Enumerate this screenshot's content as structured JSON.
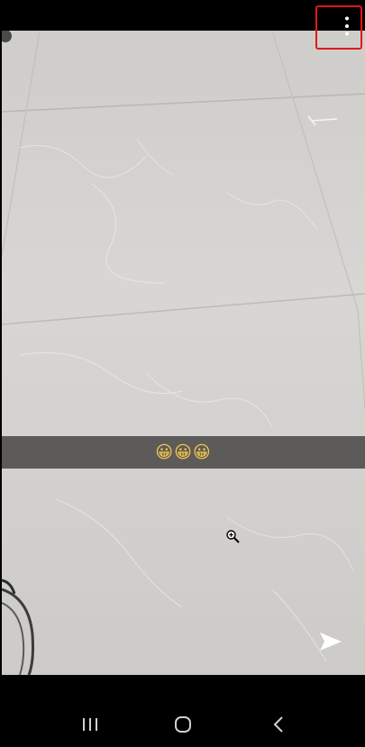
{
  "caption": {
    "text": "😀😀😀"
  },
  "icons": {
    "more": "more-vertical-icon",
    "zoom": "zoom-in-icon",
    "send": "send-icon",
    "recent_apps": "recent-apps-icon",
    "home": "home-icon",
    "back": "back-icon"
  },
  "colors": {
    "highlight_border": "#e01818",
    "nav_bar": "#000000",
    "caption_bar": "#464644",
    "floor": "#d4d2cf"
  }
}
